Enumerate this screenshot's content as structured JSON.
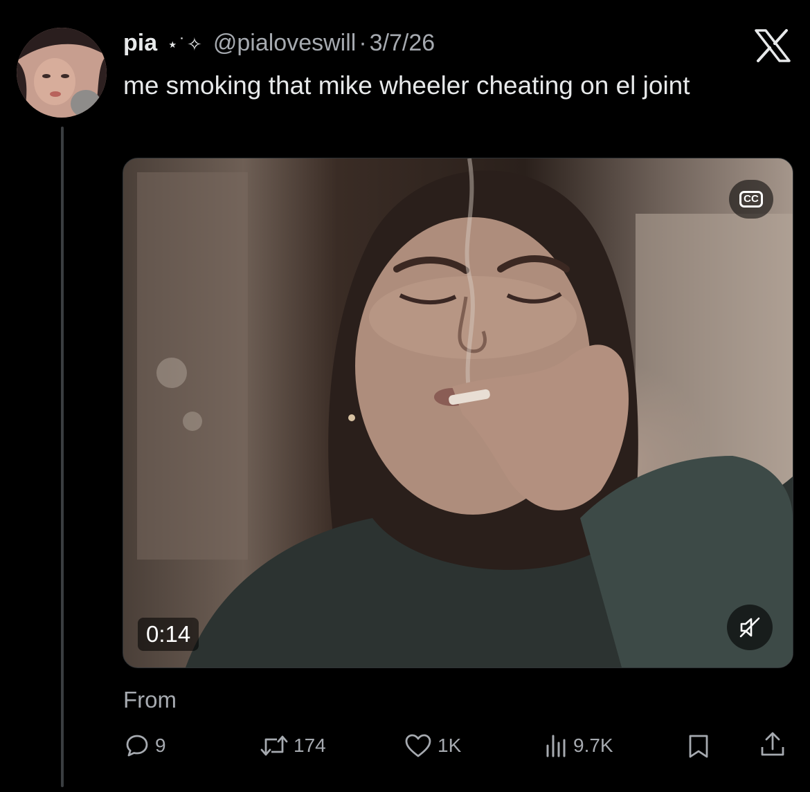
{
  "tweet": {
    "display_name": "pia",
    "name_decoration": "⋆˙✧",
    "handle": "@pialoveswill",
    "separator": "·",
    "date": "3/7/26",
    "text": "me smoking that mike wheeler cheating on el joint"
  },
  "media": {
    "duration": "0:14",
    "cc_label": "CC",
    "from_label": "From"
  },
  "actions": {
    "replies": "9",
    "retweets": "174",
    "likes": "1K",
    "views": "9.7K"
  },
  "icons": {
    "platform_logo": "x-logo-icon",
    "reply": "speech-bubble-icon",
    "retweet": "retweet-arrows-icon",
    "like": "heart-icon",
    "views": "bar-chart-icon",
    "bookmark": "bookmark-icon",
    "share": "share-upload-icon",
    "mute": "speaker-muted-icon",
    "captions": "closed-captions-icon"
  },
  "colors": {
    "background": "#000000",
    "primary_text": "#e7e9ea",
    "secondary_text": "#a6aab0",
    "thread_line": "#3a3d40"
  }
}
